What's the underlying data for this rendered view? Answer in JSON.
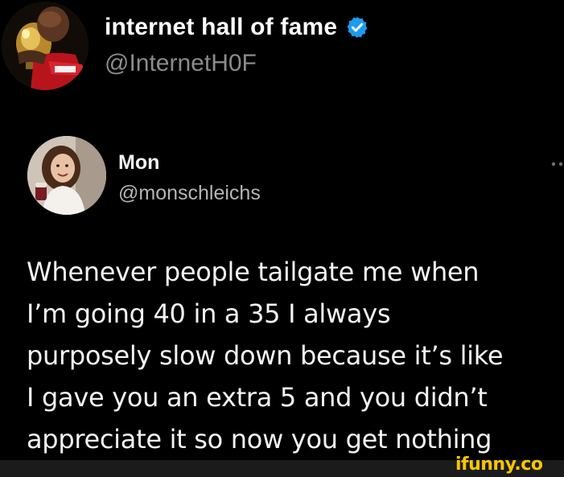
{
  "outer_tweet": {
    "display_name": "internet hall of fame",
    "handle": "@InternetH0F",
    "verified": true,
    "verified_color": "#1d9bf0",
    "avatar_icon": "avatar-photo-icon"
  },
  "inner_tweet": {
    "display_name": "Mon",
    "handle": "@monschleichs",
    "avatar_icon": "avatar-photo-icon",
    "more_icon": "more-options-icon",
    "text_lines": [
      "Whenever people tailgate me when",
      "I’m going 40 in a 35 I always",
      "purposely slow down because it’s like",
      "I gave you an extra 5 and you didn’t",
      "appreciate it so now you get nothing"
    ]
  },
  "watermark": {
    "text": "ifunny.co",
    "color": "#f7c600"
  },
  "colors": {
    "background": "#000000",
    "primary_text": "#ffffff",
    "secondary_text": "#8b8b8b"
  }
}
